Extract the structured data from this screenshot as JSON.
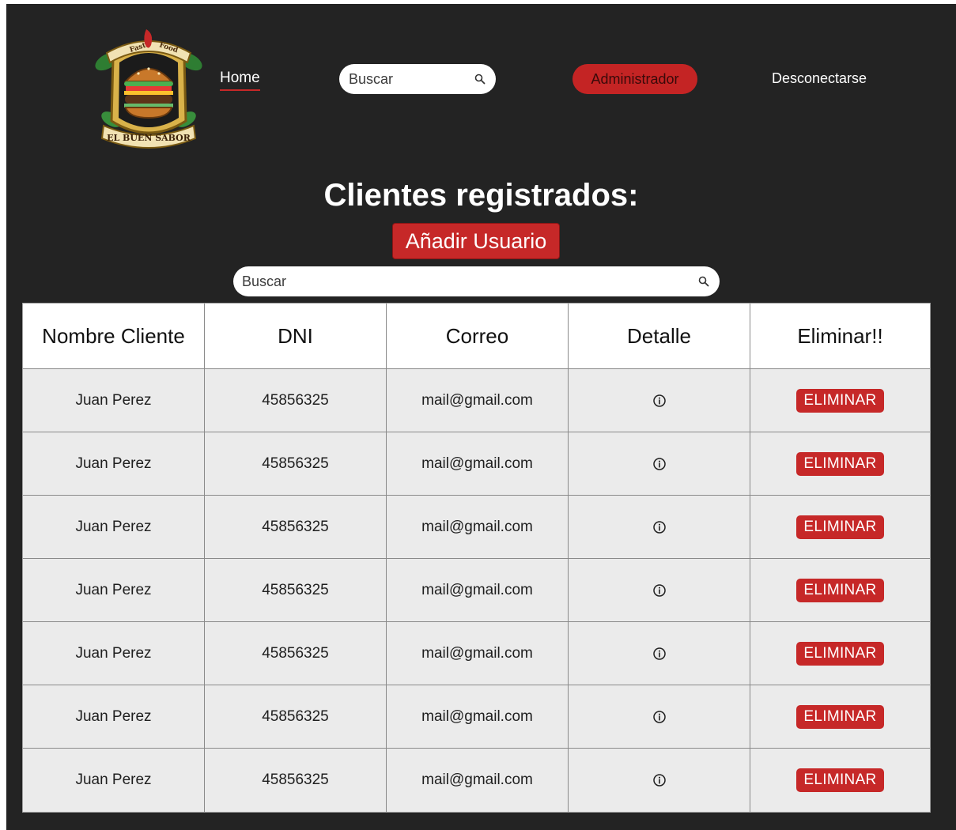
{
  "header": {
    "logo_text": "EL BUEN SABOR",
    "logo_banner_left": "Fast",
    "logo_banner_right": "Food",
    "nav_home": "Home",
    "search_placeholder": "Buscar",
    "admin_label": "Administrador",
    "logout_label": "Desconectarse"
  },
  "main": {
    "title": "Clientes registrados:",
    "add_user_label": "Añadir Usuario",
    "search_placeholder": "Buscar"
  },
  "table": {
    "columns": [
      "Nombre Cliente",
      "DNI",
      "Correo",
      "Detalle",
      "Eliminar!!"
    ],
    "rows": [
      {
        "name": "Juan Perez",
        "dni": "45856325",
        "email": "mail@gmail.com",
        "delete_label": "ELIMINAR"
      },
      {
        "name": "Juan Perez",
        "dni": "45856325",
        "email": "mail@gmail.com",
        "delete_label": "ELIMINAR"
      },
      {
        "name": "Juan Perez",
        "dni": "45856325",
        "email": "mail@gmail.com",
        "delete_label": "ELIMINAR"
      },
      {
        "name": "Juan Perez",
        "dni": "45856325",
        "email": "mail@gmail.com",
        "delete_label": "ELIMINAR"
      },
      {
        "name": "Juan Perez",
        "dni": "45856325",
        "email": "mail@gmail.com",
        "delete_label": "ELIMINAR"
      },
      {
        "name": "Juan Perez",
        "dni": "45856325",
        "email": "mail@gmail.com",
        "delete_label": "ELIMINAR"
      },
      {
        "name": "Juan Perez",
        "dni": "45856325",
        "email": "mail@gmail.com",
        "delete_label": "ELIMINAR"
      }
    ]
  },
  "colors": {
    "background": "#232323",
    "accent": "#c62828",
    "row_background": "#ebebeb"
  },
  "icons": {
    "search": "search-icon",
    "detail": "info-icon",
    "logo": "burger-logo"
  }
}
